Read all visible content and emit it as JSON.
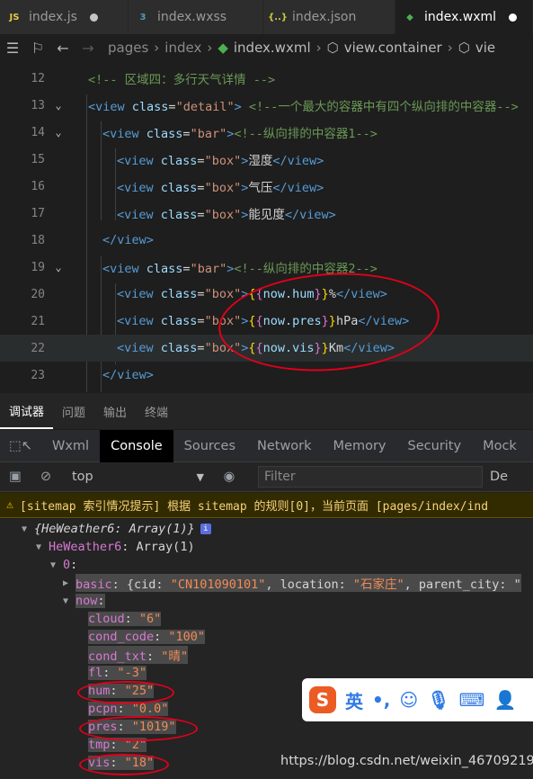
{
  "tabs": [
    {
      "icon": "js-file-icon",
      "icon_glyph": "JS",
      "icon_color": "#e8c84a",
      "label": "index.js",
      "dirty": true,
      "active": false
    },
    {
      "icon": "css-file-icon",
      "icon_glyph": "3",
      "icon_color": "#519aba",
      "label": "index.wxss",
      "dirty": false,
      "active": false
    },
    {
      "icon": "json-file-icon",
      "icon_glyph": "{..}",
      "icon_color": "#cbcb41",
      "label": "index.json",
      "dirty": false,
      "active": false
    },
    {
      "icon": "wxml-file-icon",
      "icon_glyph": "◆",
      "icon_color": "#4caf50",
      "label": "index.wxml",
      "dirty": true,
      "active": true
    }
  ],
  "breadcrumb": {
    "items": [
      "pages",
      "index",
      "index.wxml",
      "view.container",
      "vie"
    ]
  },
  "editor": {
    "lines": [
      {
        "num": "12",
        "fold": "",
        "indent": 0,
        "parts": [
          [
            "c-cm",
            "<!-- 区域四：多行天气详情 -->"
          ]
        ]
      },
      {
        "num": "13",
        "fold": "⌄",
        "indent": 0,
        "parts": [
          [
            "c-tag",
            "<view "
          ],
          [
            "c-at",
            "class"
          ],
          [
            "c-tx",
            "="
          ],
          [
            "c-str",
            "\"detail\""
          ],
          [
            "c-tag",
            "> "
          ],
          [
            "c-cm",
            "<!--一个最大的容器中有四个纵向排的中容器-->"
          ]
        ]
      },
      {
        "num": "14",
        "fold": "⌄",
        "indent": 1,
        "parts": [
          [
            "c-tag",
            "<view "
          ],
          [
            "c-at",
            "class"
          ],
          [
            "c-tx",
            "="
          ],
          [
            "c-str",
            "\"bar\""
          ],
          [
            "c-tag",
            ">"
          ],
          [
            "c-cm",
            "<!--纵向排的中容器1-->"
          ]
        ]
      },
      {
        "num": "15",
        "fold": "",
        "indent": 2,
        "parts": [
          [
            "c-tag",
            "<view "
          ],
          [
            "c-at",
            "class"
          ],
          [
            "c-tx",
            "="
          ],
          [
            "c-str",
            "\"box\""
          ],
          [
            "c-tag",
            ">"
          ],
          [
            "c-tx",
            "湿度"
          ],
          [
            "c-tag",
            "</view>"
          ]
        ]
      },
      {
        "num": "16",
        "fold": "",
        "indent": 2,
        "parts": [
          [
            "c-tag",
            "<view "
          ],
          [
            "c-at",
            "class"
          ],
          [
            "c-tx",
            "="
          ],
          [
            "c-str",
            "\"box\""
          ],
          [
            "c-tag",
            ">"
          ],
          [
            "c-tx",
            "气压"
          ],
          [
            "c-tag",
            "</view>"
          ]
        ]
      },
      {
        "num": "17",
        "fold": "",
        "indent": 2,
        "parts": [
          [
            "c-tag",
            "<view "
          ],
          [
            "c-at",
            "class"
          ],
          [
            "c-tx",
            "="
          ],
          [
            "c-str",
            "\"box\""
          ],
          [
            "c-tag",
            ">"
          ],
          [
            "c-tx",
            "能见度"
          ],
          [
            "c-tag",
            "</view>"
          ]
        ]
      },
      {
        "num": "18",
        "fold": "",
        "indent": 1,
        "parts": [
          [
            "c-tag",
            "</view>"
          ]
        ]
      },
      {
        "num": "19",
        "fold": "⌄",
        "indent": 1,
        "parts": [
          [
            "c-tag",
            "<view "
          ],
          [
            "c-at",
            "class"
          ],
          [
            "c-tx",
            "="
          ],
          [
            "c-str",
            "\"bar\""
          ],
          [
            "c-tag",
            ">"
          ],
          [
            "c-cm",
            "<!--纵向排的中容器2-->"
          ]
        ]
      },
      {
        "num": "20",
        "fold": "",
        "indent": 2,
        "parts": [
          [
            "c-tag",
            "<view "
          ],
          [
            "c-at",
            "class"
          ],
          [
            "c-tx",
            "="
          ],
          [
            "c-str",
            "\"box\""
          ],
          [
            "c-tag",
            ">"
          ],
          [
            "c-br",
            "{"
          ],
          [
            "c-br2",
            "{"
          ],
          [
            "c-var",
            "now.hum"
          ],
          [
            "c-br2",
            "}"
          ],
          [
            "c-br",
            "}"
          ],
          [
            "c-tx",
            "%"
          ],
          [
            "c-tag",
            "</view>"
          ]
        ]
      },
      {
        "num": "21",
        "fold": "",
        "indent": 2,
        "parts": [
          [
            "c-tag",
            "<view "
          ],
          [
            "c-at",
            "class"
          ],
          [
            "c-tx",
            "="
          ],
          [
            "c-str",
            "\"box\""
          ],
          [
            "c-tag",
            ">"
          ],
          [
            "c-br",
            "{"
          ],
          [
            "c-br2",
            "{"
          ],
          [
            "c-var",
            "now.pres"
          ],
          [
            "c-br2",
            "}"
          ],
          [
            "c-br",
            "}"
          ],
          [
            "c-tx",
            "hPa"
          ],
          [
            "c-tag",
            "</view>"
          ]
        ]
      },
      {
        "num": "22",
        "fold": "",
        "indent": 2,
        "current": true,
        "parts": [
          [
            "c-tag",
            "<view "
          ],
          [
            "c-at",
            "class"
          ],
          [
            "c-tx",
            "="
          ],
          [
            "c-str",
            "\"box\""
          ],
          [
            "c-tag",
            ">"
          ],
          [
            "c-br",
            "{"
          ],
          [
            "c-br2",
            "{"
          ],
          [
            "c-var",
            "now.vis"
          ],
          [
            "c-br2",
            "}"
          ],
          [
            "c-br",
            "}"
          ],
          [
            "c-tx",
            "Km"
          ],
          [
            "c-tag",
            "</view>"
          ]
        ]
      },
      {
        "num": "23",
        "fold": "",
        "indent": 1,
        "parts": [
          [
            "c-tag",
            "</view>"
          ]
        ]
      }
    ]
  },
  "devtools": {
    "top_tabs": [
      "调试器",
      "问题",
      "输出",
      "终端"
    ],
    "panel_tabs": [
      "Wxml",
      "Console",
      "Sources",
      "Network",
      "Memory",
      "Security",
      "Mock"
    ],
    "active_panel": "Console",
    "context_value": "top",
    "filter_placeholder": "Filter",
    "default_levels_label": "De",
    "warning_text": "[sitemap 索引情况提示] 根据 sitemap 的规则[0]，当前页面 [pages/index/ind"
  },
  "console": {
    "root_label": "{HeWeather6: Array(1)}",
    "child_key": "HeWeather6",
    "child_val": "Array(1)",
    "index_key": "0",
    "basic_key": "basic",
    "basic_preview_pre": "{cid: ",
    "basic_cid": "\"CN101090101\"",
    "basic_mid": ", location: ",
    "basic_location": "\"石家庄\"",
    "basic_tail": ", parent_city: \"",
    "now_key": "now",
    "now_fields": [
      {
        "key": "cloud",
        "value": "\"6\""
      },
      {
        "key": "cond_code",
        "value": "\"100\""
      },
      {
        "key": "cond_txt",
        "value": "\"晴\""
      },
      {
        "key": "fl",
        "value": "\"-3\""
      },
      {
        "key": "hum",
        "value": "\"25\""
      },
      {
        "key": "pcpn",
        "value": "\"0.0\""
      },
      {
        "key": "pres",
        "value": "\"1019\""
      },
      {
        "key": "tmp",
        "value": "\"2\""
      },
      {
        "key": "vis",
        "value": "\"18\""
      }
    ]
  },
  "ime": {
    "logo": "S",
    "mode": "英",
    "punct": "•,"
  },
  "watermark": "https://blog.csdn.net/weixin_46709219"
}
